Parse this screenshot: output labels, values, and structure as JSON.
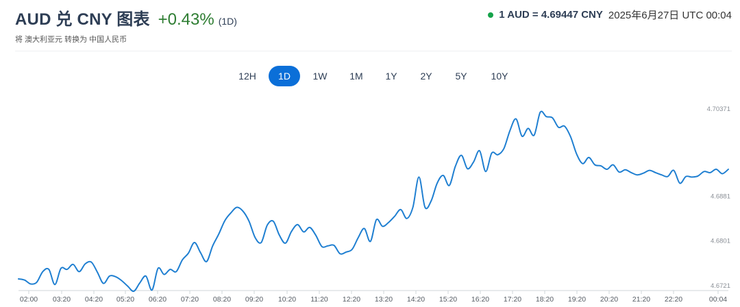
{
  "header": {
    "title": "AUD 兑 CNY 图表",
    "change": "+0.43%",
    "range_tag": "(1D)",
    "subtitle": "将 澳大利亚元 转换为 中国人民币",
    "rate": "1 AUD = 4.69447 CNY",
    "timestamp": "2025年6月27日 UTC 00:04",
    "status_color": "#16a34a"
  },
  "tabs": [
    {
      "label": "12H",
      "active": false
    },
    {
      "label": "1D",
      "active": true
    },
    {
      "label": "1W",
      "active": false
    },
    {
      "label": "1M",
      "active": false
    },
    {
      "label": "1Y",
      "active": false
    },
    {
      "label": "2Y",
      "active": false
    },
    {
      "label": "5Y",
      "active": false
    },
    {
      "label": "10Y",
      "active": false
    }
  ],
  "chart_data": {
    "type": "line",
    "title": "",
    "xlabel": "",
    "ylabel": "",
    "ylim": [
      4.6721,
      4.7037
    ],
    "yticks": [
      "4.70371",
      "4.6881",
      "4.6801",
      "4.6721"
    ],
    "xticks": [
      "02:00",
      "03:20",
      "04:20",
      "05:20",
      "06:20",
      "07:20",
      "08:20",
      "09:20",
      "10:20",
      "11:20",
      "12:20",
      "13:20",
      "14:20",
      "15:20",
      "16:20",
      "17:20",
      "18:20",
      "19:20",
      "20:20",
      "21:20",
      "22:20",
      "00:04"
    ],
    "line_color": "#1f7fd1",
    "grid": false,
    "series": [
      {
        "values": [
          4.6732,
          4.673,
          4.6723,
          4.6726,
          4.6745,
          4.6749,
          4.6722,
          4.6751,
          4.6749,
          4.6758,
          4.6745,
          4.6759,
          4.6762,
          4.6744,
          4.6724,
          4.6737,
          4.6736,
          4.6729,
          4.6719,
          4.671,
          4.6725,
          4.6737,
          4.6712,
          4.6751,
          4.674,
          4.6749,
          4.6745,
          4.6766,
          4.6778,
          4.6797,
          4.6779,
          4.6763,
          4.6791,
          4.6812,
          4.6836,
          4.685,
          4.686,
          4.6853,
          4.6835,
          4.6806,
          4.6797,
          4.6828,
          4.6835,
          4.681,
          4.6796,
          4.6817,
          4.6829,
          4.6816,
          4.6824,
          4.681,
          4.679,
          4.6791,
          4.6792,
          4.6777,
          4.678,
          4.6785,
          4.6806,
          4.6822,
          4.6799,
          4.6838,
          4.6826,
          4.6833,
          4.6844,
          4.6856,
          4.684,
          4.686,
          4.6914,
          4.686,
          4.6871,
          4.6903,
          4.6917,
          4.6899,
          4.6933,
          4.6953,
          4.6929,
          4.6941,
          4.6961,
          4.6924,
          4.6957,
          4.6954,
          4.6965,
          4.6997,
          4.7018,
          4.6987,
          4.7001,
          4.6989,
          4.703,
          4.7022,
          4.702,
          4.7003,
          4.7005,
          4.6986,
          4.6955,
          4.6938,
          4.6949,
          4.6936,
          4.6934,
          4.6928,
          4.6936,
          4.6923,
          4.6927,
          4.6922,
          4.6918,
          4.6921,
          4.6926,
          4.6922,
          4.6918,
          4.6915,
          4.6926,
          4.6903,
          4.6915,
          4.6914,
          4.6916,
          4.6924,
          4.6922,
          4.6928,
          4.692,
          4.6928
        ]
      }
    ]
  }
}
